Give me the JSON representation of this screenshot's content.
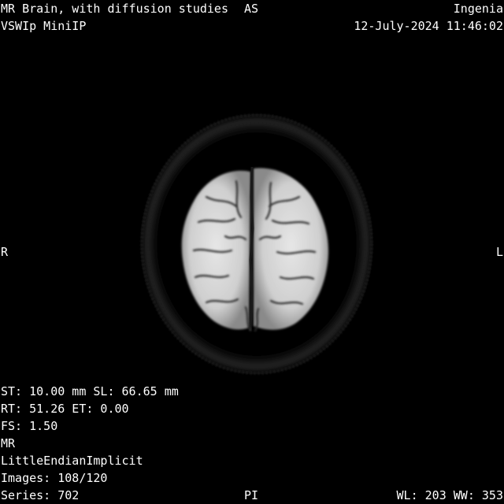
{
  "study": {
    "description": "MR Brain, with diffusion studies",
    "series_description": "VSWIp MiniIP",
    "institution": "Ingenia",
    "date_time": "12-July-2024 11:46:02"
  },
  "orientation": {
    "top": "AS",
    "left": "R",
    "right": "L",
    "bottom": "PI"
  },
  "acquisition": {
    "thickness_location": "ST: 10.00 mm SL: 66.65 mm",
    "rt_et": "RT: 51.26 ET: 0.00",
    "field_strength": "FS: 1.50",
    "modality": "MR",
    "transfer_syntax": "LittleEndianImplicit",
    "images": "Images: 108/120",
    "series": "Series: 702"
  },
  "window": {
    "level_width": "WL: 203 WW: 353"
  },
  "colors": {
    "background": "#000000",
    "text": "#ffffff"
  }
}
